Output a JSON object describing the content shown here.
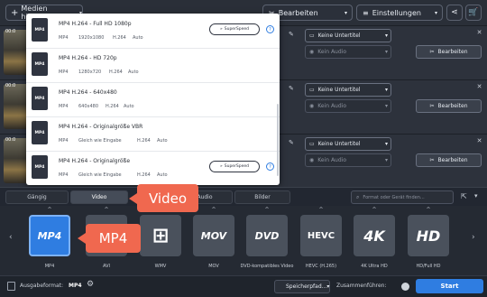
{
  "toolbar": {
    "add_media_label": "Medien hinzufügen",
    "edit_label": "Bearbeiten",
    "settings_label": "Einstellungen"
  },
  "files": [
    {
      "time": "00:0",
      "subtitle": "Keine Untertitel",
      "audio": "Kein Audio",
      "edit_label": "Bearbeiten"
    },
    {
      "time": "00:0",
      "subtitle": "Keine Untertitel",
      "audio": "Kein Audio",
      "edit_label": "Bearbeiten"
    },
    {
      "time": "00:0",
      "subtitle": "Keine Untertitel",
      "audio": "Kein Audio",
      "edit_label": "Bearbeiten"
    }
  ],
  "dropdown": {
    "items": [
      {
        "icon_label": "MP4",
        "title": "MP4 H.264 - Full HD 1080p",
        "meta": [
          "MP4",
          "1920x1080",
          "H.264",
          "Auto"
        ],
        "superspeed": "SuperSpeed"
      },
      {
        "icon_label": "MP4",
        "title": "MP4 H.264 - HD 720p",
        "meta": [
          "MP4",
          "1280x720",
          "H.264",
          "Auto"
        ]
      },
      {
        "icon_label": "MP4",
        "title": "MP4 H.264 - 640x480",
        "meta": [
          "MP4",
          "640x480",
          "H.264",
          "Auto"
        ]
      },
      {
        "icon_label": "MP4",
        "title": "MP4 H.264 - Originalgröße VBR",
        "meta": [
          "MP4",
          "Gleich wie Eingabe",
          "H.264",
          "Auto"
        ]
      },
      {
        "icon_label": "MP4",
        "title": "MP4 H.264 - Originalgröße",
        "meta": [
          "MP4",
          "Gleich wie Eingabe",
          "H.264",
          "Auto"
        ],
        "superspeed": "SuperSpeed"
      }
    ]
  },
  "tabs": [
    "Gängig",
    "Video",
    "Audio",
    "Bilder"
  ],
  "search": {
    "placeholder": "Format oder Gerät finden..."
  },
  "callouts": {
    "video": "Video",
    "mp4": "MP4"
  },
  "formats": [
    {
      "logo": "MP4",
      "label": "MP4"
    },
    {
      "logo": "",
      "label": "AVI"
    },
    {
      "logo": "⊞",
      "label": "WMV"
    },
    {
      "logo": "MOV",
      "label": "MOV"
    },
    {
      "logo": "DVD",
      "label": "DVD-kompatibles Video"
    },
    {
      "logo": "HEVC",
      "label": "HEVC (H.265)"
    },
    {
      "logo": "4K",
      "label": "4K Ultra HD"
    },
    {
      "logo": "HD",
      "label": "HD/Full HD"
    }
  ],
  "bottom": {
    "output_format_label": "Ausgabeformat:",
    "output_format_value": "MP4",
    "save_path_label": "Speicherpfad...",
    "merge_label": "Zusammenführen:",
    "start_label": "Start"
  },
  "colors": {
    "accent": "#2f7de1",
    "callout": "#f0684f"
  }
}
